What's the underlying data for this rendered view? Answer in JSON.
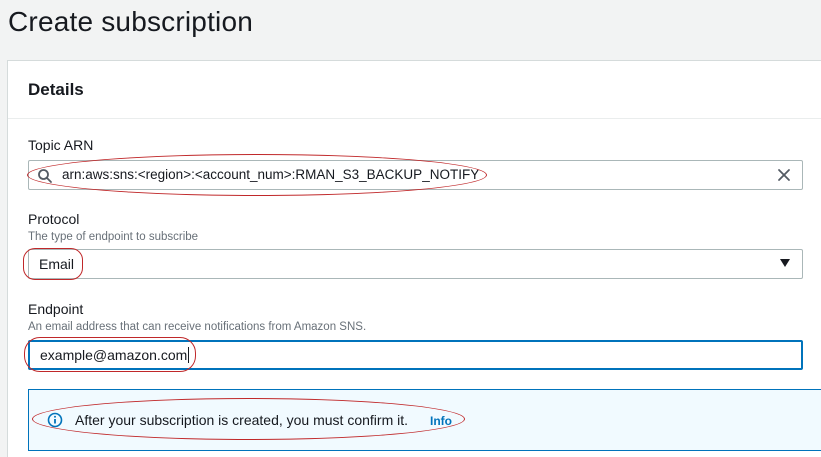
{
  "page": {
    "title": "Create subscription"
  },
  "details": {
    "heading": "Details",
    "topic_arn": {
      "label": "Topic ARN",
      "value": "arn:aws:sns:<region>:<account_num>:RMAN_S3_BACKUP_NOTIFY"
    },
    "protocol": {
      "label": "Protocol",
      "description": "The type of endpoint to subscribe",
      "selected": "Email"
    },
    "endpoint": {
      "label": "Endpoint",
      "description": "An email address that can receive notifications from Amazon SNS.",
      "value": "example@amazon.com"
    },
    "alert": {
      "message": "After your subscription is created, you must confirm it.",
      "link": "Info"
    }
  },
  "icons": {
    "search": "search-icon",
    "clear": "close-icon",
    "dropdown": "caret-down-icon",
    "info": "info-icon"
  },
  "colors": {
    "accent": "#0073bb",
    "annotation": "#c0282a",
    "alert_background": "#f1faff"
  }
}
